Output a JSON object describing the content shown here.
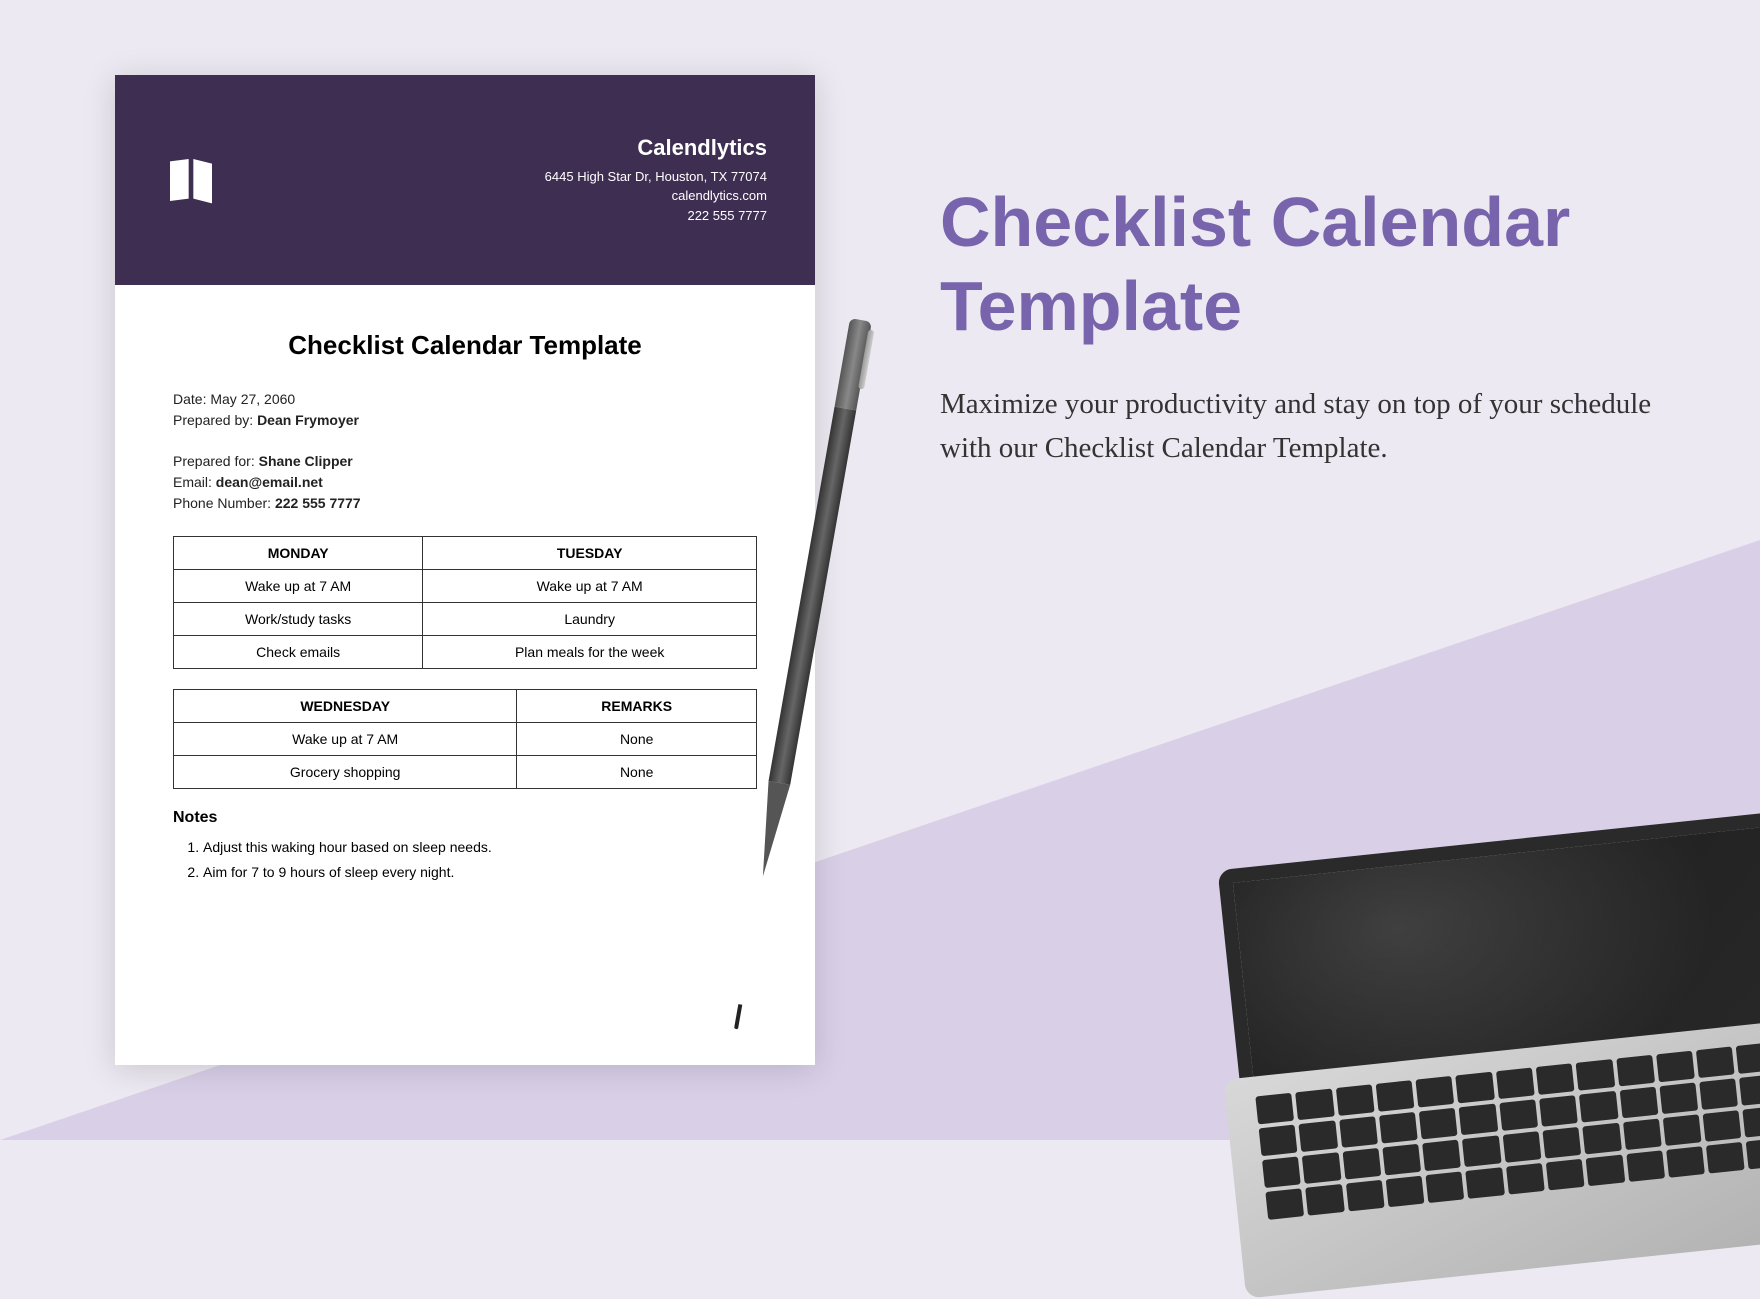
{
  "company": {
    "name": "Calendlytics",
    "address": "6445 High Star Dr, Houston, TX 77074",
    "website": "calendlytics.com",
    "phone": "222 555 7777"
  },
  "document": {
    "title": "Checklist Calendar Template",
    "date_label": "Date:",
    "date": "May 27, 2060",
    "prepared_by_label": "Prepared by:",
    "prepared_by": "Dean Frymoyer",
    "prepared_for_label": "Prepared for:",
    "prepared_for": "Shane Clipper",
    "email_label": "Email:",
    "email": "dean@email.net",
    "phone_label": "Phone Number:",
    "phone": "222 555 7777"
  },
  "table1": {
    "headers": [
      "MONDAY",
      "TUESDAY"
    ],
    "rows": [
      [
        "Wake up at 7 AM",
        "Wake up at 7 AM"
      ],
      [
        "Work/study tasks",
        "Laundry"
      ],
      [
        "Check emails",
        "Plan meals for the week"
      ]
    ]
  },
  "table2": {
    "headers": [
      "WEDNESDAY",
      "REMARKS"
    ],
    "rows": [
      [
        "Wake up at 7 AM",
        "None"
      ],
      [
        "Grocery shopping",
        "None"
      ]
    ]
  },
  "notes": {
    "heading": "Notes",
    "items": [
      "Adjust this waking hour based on sleep needs.",
      "Aim for 7 to 9 hours of sleep every night."
    ]
  },
  "hero": {
    "title": "Checklist Calendar Template",
    "description": "Maximize your productivity and stay on top of your schedule with our Checklist Calendar Template."
  }
}
